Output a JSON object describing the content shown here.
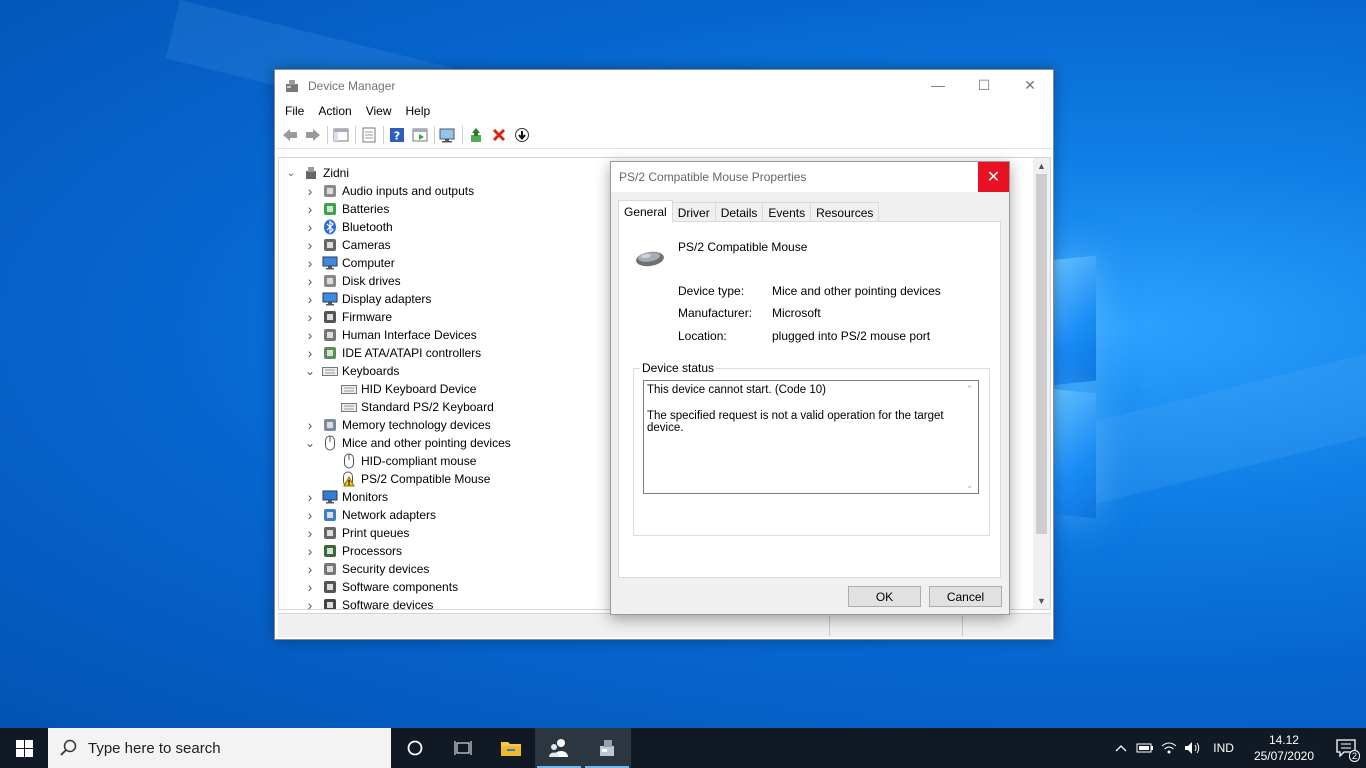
{
  "device_manager": {
    "title": "Device Manager",
    "menu": [
      "File",
      "Action",
      "View",
      "Help"
    ],
    "tree": {
      "root": "Zidni",
      "rows": [
        {
          "label": "Audio inputs and outputs",
          "expanded": false,
          "level": 1,
          "icon": "speaker-icon"
        },
        {
          "label": "Batteries",
          "expanded": false,
          "level": 1,
          "icon": "battery-icon"
        },
        {
          "label": "Bluetooth",
          "expanded": false,
          "level": 1,
          "icon": "bluetooth-icon"
        },
        {
          "label": "Cameras",
          "expanded": false,
          "level": 1,
          "icon": "camera-icon"
        },
        {
          "label": "Computer",
          "expanded": false,
          "level": 1,
          "icon": "computer-icon"
        },
        {
          "label": "Disk drives",
          "expanded": false,
          "level": 1,
          "icon": "disk-icon"
        },
        {
          "label": "Display adapters",
          "expanded": false,
          "level": 1,
          "icon": "display-icon"
        },
        {
          "label": "Firmware",
          "expanded": false,
          "level": 1,
          "icon": "chip-icon"
        },
        {
          "label": "Human Interface Devices",
          "expanded": false,
          "level": 1,
          "icon": "hid-icon"
        },
        {
          "label": "IDE ATA/ATAPI controllers",
          "expanded": false,
          "level": 1,
          "icon": "controller-icon"
        },
        {
          "label": "Keyboards",
          "expanded": true,
          "level": 1,
          "icon": "keyboard-icon"
        },
        {
          "label": "HID Keyboard Device",
          "level": 2,
          "icon": "keyboard-icon"
        },
        {
          "label": "Standard PS/2 Keyboard",
          "level": 2,
          "icon": "keyboard-icon"
        },
        {
          "label": "Memory technology devices",
          "expanded": false,
          "level": 1,
          "icon": "memory-icon"
        },
        {
          "label": "Mice and other pointing devices",
          "expanded": true,
          "level": 1,
          "icon": "mouse-icon"
        },
        {
          "label": "HID-compliant mouse",
          "level": 2,
          "icon": "mouse-icon"
        },
        {
          "label": "PS/2 Compatible Mouse",
          "level": 2,
          "icon": "mouse-warning-icon"
        },
        {
          "label": "Monitors",
          "expanded": false,
          "level": 1,
          "icon": "monitor-icon"
        },
        {
          "label": "Network adapters",
          "expanded": false,
          "level": 1,
          "icon": "network-icon"
        },
        {
          "label": "Print queues",
          "expanded": false,
          "level": 1,
          "icon": "printer-icon"
        },
        {
          "label": "Processors",
          "expanded": false,
          "level": 1,
          "icon": "processor-icon"
        },
        {
          "label": "Security devices",
          "expanded": false,
          "level": 1,
          "icon": "security-icon"
        },
        {
          "label": "Software components",
          "expanded": false,
          "level": 1,
          "icon": "software-component-icon"
        },
        {
          "label": "Software devices",
          "expanded": false,
          "level": 1,
          "icon": "software-device-icon"
        }
      ]
    }
  },
  "properties": {
    "title": "PS/2 Compatible Mouse Properties",
    "tabs": [
      "General",
      "Driver",
      "Details",
      "Events",
      "Resources"
    ],
    "device_name": "PS/2 Compatible Mouse",
    "device_type_label": "Device type:",
    "device_type_value": "Mice and other pointing devices",
    "manufacturer_label": "Manufacturer:",
    "manufacturer_value": "Microsoft",
    "location_label": "Location:",
    "location_value": "plugged into PS/2 mouse port",
    "status_group": "Device status",
    "status_line1": "This device cannot start. (Code 10)",
    "status_line2": "The specified request is not a valid operation for the target device.",
    "ok": "OK",
    "cancel": "Cancel"
  },
  "taskbar": {
    "search_placeholder": "Type here to search",
    "language": "IND",
    "time": "14.12",
    "date": "25/07/2020",
    "notification_count": "2"
  }
}
